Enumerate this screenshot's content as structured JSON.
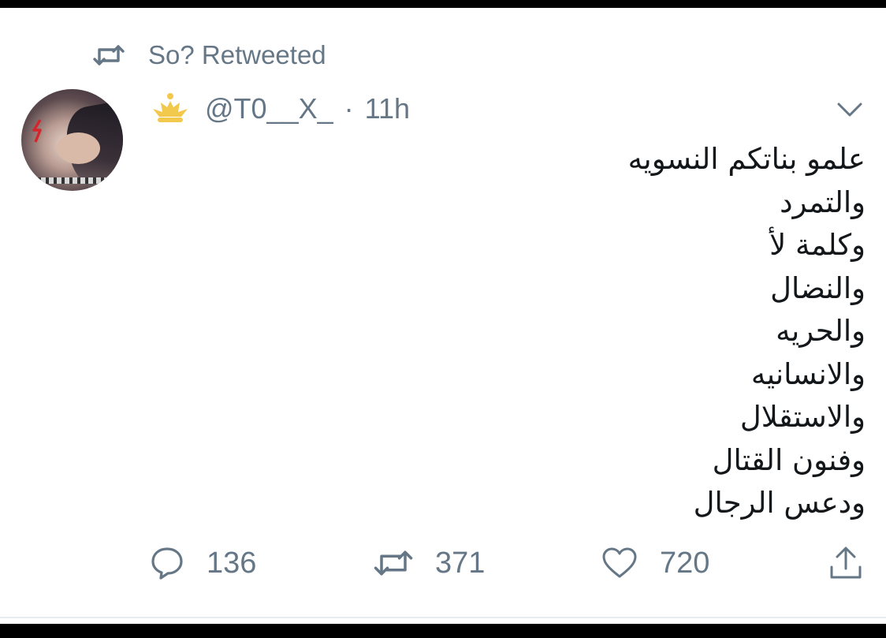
{
  "retweet_context": {
    "icon": "retweet-icon",
    "text": "So? Retweeted"
  },
  "tweet": {
    "avatar_icon": "avatar",
    "badge_icon": "crown-badge-icon",
    "handle": "@T0__X_",
    "separator": "·",
    "time": "11h",
    "menu_icon": "chevron-down-icon",
    "text_lines": [
      "علمو بناتكم النسويه",
      "والتمرد",
      "وكلمة لأ",
      "والنضال",
      "والحريه",
      "والانسانيه",
      "والاستقلال",
      "وفنون القتال",
      "ودعس الرجال"
    ]
  },
  "actions": {
    "reply": {
      "icon": "reply-icon",
      "count": "136"
    },
    "retweet": {
      "icon": "retweet-icon",
      "count": "371"
    },
    "like": {
      "icon": "heart-icon",
      "count": "720"
    },
    "share": {
      "icon": "share-icon"
    }
  },
  "colors": {
    "text_primary": "#14171a",
    "text_secondary": "#657786",
    "badge_gold": "#f2c94c"
  }
}
